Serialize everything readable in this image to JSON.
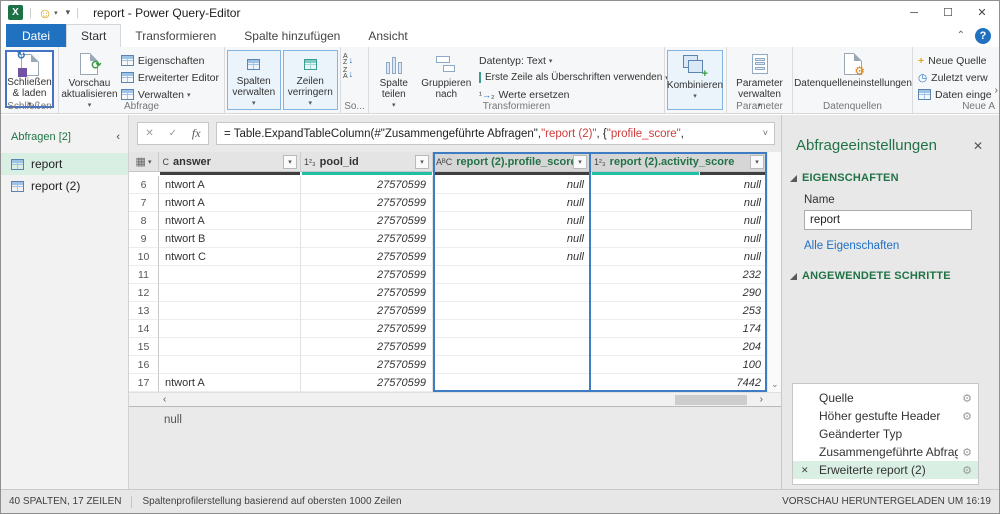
{
  "colors": {
    "accent_green": "#217346",
    "quality_teal": "#1fc0a5",
    "quality_dark": "#3f3f3f",
    "selection_blue": "#3e7dc4",
    "datei_blue": "#2072c0",
    "formula_string_red": "#ce3c3c",
    "link_blue": "#1f6fc4",
    "selected_row_green": "#d9efe4"
  },
  "icons": {
    "caret": "▾",
    "chevron_left": "‹",
    "chevron_right": "›",
    "collapse_ribbon": "⌃",
    "help": "?",
    "close": "✕",
    "check": "✓",
    "fx": "fx",
    "gear": "⚙",
    "type_number": "1²₃",
    "type_text": "AᴮC",
    "type_text_partial": "C",
    "corner_grid": "▦",
    "minimize": "─",
    "maximize": "☐",
    "smiley": "☺",
    "excel_logo": "X",
    "formula_expand": "˅",
    "scroll_down": "⌄",
    "orange_gear": "⚙",
    "green_refresh": "⟳",
    "blue_arrow": "↻",
    "replace_one": "¹",
    "replace_arrow": "→",
    "replace_two": "₂",
    "plus": "+",
    "clock": "◷",
    "sort_a": "A",
    "sort_z": "Z",
    "sort_down": "↓"
  },
  "titlebar": {
    "title": "report - Power Query-Editor"
  },
  "tabs": [
    {
      "label": "Datei"
    },
    {
      "label": "Start"
    },
    {
      "label": "Transformieren"
    },
    {
      "label": "Spalte hinzufügen"
    },
    {
      "label": "Ansicht"
    }
  ],
  "ribbon": {
    "close_load": "Schließen & laden",
    "close_group": "Schließen",
    "refresh": "Vorschau aktualisieren",
    "properties": "Eigenschaften",
    "advanced_editor": "Erweiterter Editor",
    "manage": "Verwalten",
    "query_group": "Abfrage",
    "manage_columns": "Spalten verwalten",
    "reduce_rows": "Zeilen verringern",
    "sort_group": "So...",
    "split_column": "Spalte teilen",
    "group_by": "Gruppieren nach",
    "datatype": "Datentyp: Text",
    "use_first_row": "Erste Zeile als Überschriften verwenden",
    "replace_values": "Werte ersetzen",
    "transform_group": "Transformieren",
    "combine": "Kombinieren",
    "manage_parameters": "Parameter verwalten",
    "parameter_group": "Parameter",
    "datasource_settings": "Datenquelleneinstellungen",
    "datasource_group": "Datenquellen",
    "new_source": "Neue Quelle",
    "recent_sources": "Zuletzt verw",
    "enter_data": "Daten einge",
    "new_group": "Neue A"
  },
  "formula": {
    "part1": "= Table.ExpandTableColumn(#\"Zusammengeführte Abfragen\", ",
    "part2": "\"report (2)\"",
    "part3": ", {",
    "part4": "\"profile_score\"",
    "part5": ","
  },
  "queries": {
    "header": "Abfragen [2]",
    "items": [
      {
        "label": "report",
        "selected": true
      },
      {
        "label": "report (2)",
        "selected": false
      }
    ]
  },
  "grid": {
    "columns": [
      {
        "label": "answer",
        "type": "text",
        "selected": false
      },
      {
        "label": "pool_id",
        "type": "number",
        "selected": false
      },
      {
        "label": "report (2).profile_score",
        "type": "text",
        "selected": true
      },
      {
        "label": "report (2).activity_score",
        "type": "number",
        "selected": true
      }
    ],
    "rows": [
      [
        "6",
        "ntwort A",
        "27570599",
        "null",
        "null"
      ],
      [
        "7",
        "ntwort A",
        "27570599",
        "null",
        "null"
      ],
      [
        "8",
        "ntwort A",
        "27570599",
        "null",
        "null"
      ],
      [
        "9",
        "ntwort B",
        "27570599",
        "null",
        "null"
      ],
      [
        "10",
        "ntwort C",
        "27570599",
        "null",
        "null"
      ],
      [
        "11",
        "",
        "27570599",
        "",
        "232"
      ],
      [
        "12",
        "",
        "27570599",
        "",
        "290"
      ],
      [
        "13",
        "",
        "27570599",
        "",
        "253"
      ],
      [
        "14",
        "",
        "27570599",
        "",
        "174"
      ],
      [
        "15",
        "",
        "27570599",
        "",
        "204"
      ],
      [
        "16",
        "",
        "27570599",
        "",
        "100"
      ],
      [
        "17",
        "ntwort A",
        "27570599",
        "",
        "7442"
      ]
    ]
  },
  "preview": {
    "value": "null"
  },
  "settings": {
    "title": "Abfrageeinstellungen",
    "properties_label": "EIGENSCHAFTEN",
    "name_label": "Name",
    "name_value": "report",
    "all_properties": "Alle Eigenschaften",
    "steps_label": "ANGEWENDETE SCHRITTE",
    "steps": [
      {
        "label": "Quelle",
        "gear": true,
        "selected": false
      },
      {
        "label": "Höher gestufte Header",
        "gear": true,
        "selected": false
      },
      {
        "label": "Geänderter Typ",
        "gear": false,
        "selected": false
      },
      {
        "label": "Zusammengeführte Abfragen",
        "gear": true,
        "selected": false
      },
      {
        "label": "Erweiterte report (2)",
        "gear": true,
        "selected": true
      }
    ]
  },
  "status": {
    "left1": "40 SPALTEN, 17 ZEILEN",
    "left2": "Spaltenprofilerstellung basierend auf obersten 1000 Zeilen",
    "right": "VORSCHAU HERUNTERGELADEN UM 16:19"
  }
}
